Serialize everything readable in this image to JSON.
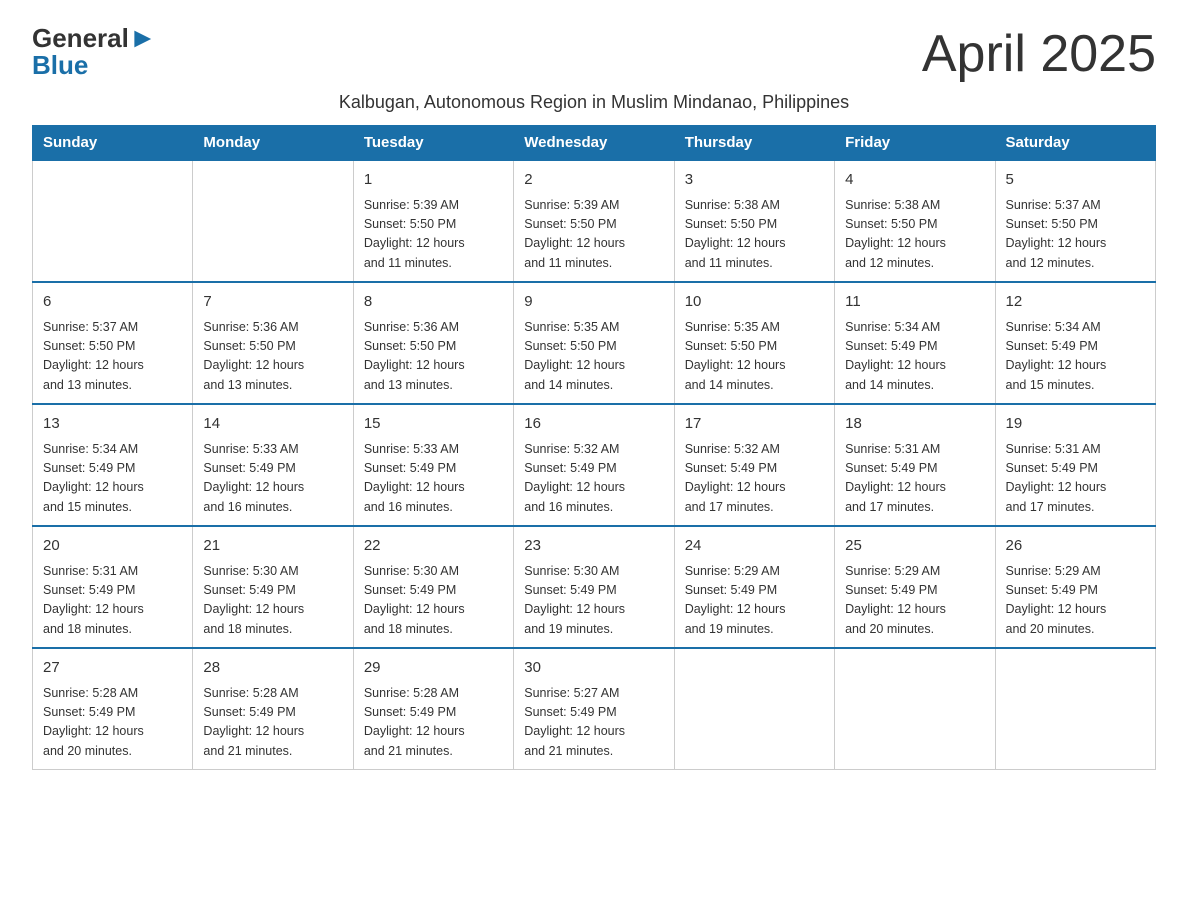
{
  "header": {
    "logo_general": "General",
    "logo_blue": "Blue",
    "month_title": "April 2025",
    "subtitle": "Kalbugan, Autonomous Region in Muslim Mindanao, Philippines"
  },
  "weekdays": [
    "Sunday",
    "Monday",
    "Tuesday",
    "Wednesday",
    "Thursday",
    "Friday",
    "Saturday"
  ],
  "weeks": [
    [
      {
        "day": "",
        "detail": ""
      },
      {
        "day": "",
        "detail": ""
      },
      {
        "day": "1",
        "detail": "Sunrise: 5:39 AM\nSunset: 5:50 PM\nDaylight: 12 hours\nand 11 minutes."
      },
      {
        "day": "2",
        "detail": "Sunrise: 5:39 AM\nSunset: 5:50 PM\nDaylight: 12 hours\nand 11 minutes."
      },
      {
        "day": "3",
        "detail": "Sunrise: 5:38 AM\nSunset: 5:50 PM\nDaylight: 12 hours\nand 11 minutes."
      },
      {
        "day": "4",
        "detail": "Sunrise: 5:38 AM\nSunset: 5:50 PM\nDaylight: 12 hours\nand 12 minutes."
      },
      {
        "day": "5",
        "detail": "Sunrise: 5:37 AM\nSunset: 5:50 PM\nDaylight: 12 hours\nand 12 minutes."
      }
    ],
    [
      {
        "day": "6",
        "detail": "Sunrise: 5:37 AM\nSunset: 5:50 PM\nDaylight: 12 hours\nand 13 minutes."
      },
      {
        "day": "7",
        "detail": "Sunrise: 5:36 AM\nSunset: 5:50 PM\nDaylight: 12 hours\nand 13 minutes."
      },
      {
        "day": "8",
        "detail": "Sunrise: 5:36 AM\nSunset: 5:50 PM\nDaylight: 12 hours\nand 13 minutes."
      },
      {
        "day": "9",
        "detail": "Sunrise: 5:35 AM\nSunset: 5:50 PM\nDaylight: 12 hours\nand 14 minutes."
      },
      {
        "day": "10",
        "detail": "Sunrise: 5:35 AM\nSunset: 5:50 PM\nDaylight: 12 hours\nand 14 minutes."
      },
      {
        "day": "11",
        "detail": "Sunrise: 5:34 AM\nSunset: 5:49 PM\nDaylight: 12 hours\nand 14 minutes."
      },
      {
        "day": "12",
        "detail": "Sunrise: 5:34 AM\nSunset: 5:49 PM\nDaylight: 12 hours\nand 15 minutes."
      }
    ],
    [
      {
        "day": "13",
        "detail": "Sunrise: 5:34 AM\nSunset: 5:49 PM\nDaylight: 12 hours\nand 15 minutes."
      },
      {
        "day": "14",
        "detail": "Sunrise: 5:33 AM\nSunset: 5:49 PM\nDaylight: 12 hours\nand 16 minutes."
      },
      {
        "day": "15",
        "detail": "Sunrise: 5:33 AM\nSunset: 5:49 PM\nDaylight: 12 hours\nand 16 minutes."
      },
      {
        "day": "16",
        "detail": "Sunrise: 5:32 AM\nSunset: 5:49 PM\nDaylight: 12 hours\nand 16 minutes."
      },
      {
        "day": "17",
        "detail": "Sunrise: 5:32 AM\nSunset: 5:49 PM\nDaylight: 12 hours\nand 17 minutes."
      },
      {
        "day": "18",
        "detail": "Sunrise: 5:31 AM\nSunset: 5:49 PM\nDaylight: 12 hours\nand 17 minutes."
      },
      {
        "day": "19",
        "detail": "Sunrise: 5:31 AM\nSunset: 5:49 PM\nDaylight: 12 hours\nand 17 minutes."
      }
    ],
    [
      {
        "day": "20",
        "detail": "Sunrise: 5:31 AM\nSunset: 5:49 PM\nDaylight: 12 hours\nand 18 minutes."
      },
      {
        "day": "21",
        "detail": "Sunrise: 5:30 AM\nSunset: 5:49 PM\nDaylight: 12 hours\nand 18 minutes."
      },
      {
        "day": "22",
        "detail": "Sunrise: 5:30 AM\nSunset: 5:49 PM\nDaylight: 12 hours\nand 18 minutes."
      },
      {
        "day": "23",
        "detail": "Sunrise: 5:30 AM\nSunset: 5:49 PM\nDaylight: 12 hours\nand 19 minutes."
      },
      {
        "day": "24",
        "detail": "Sunrise: 5:29 AM\nSunset: 5:49 PM\nDaylight: 12 hours\nand 19 minutes."
      },
      {
        "day": "25",
        "detail": "Sunrise: 5:29 AM\nSunset: 5:49 PM\nDaylight: 12 hours\nand 20 minutes."
      },
      {
        "day": "26",
        "detail": "Sunrise: 5:29 AM\nSunset: 5:49 PM\nDaylight: 12 hours\nand 20 minutes."
      }
    ],
    [
      {
        "day": "27",
        "detail": "Sunrise: 5:28 AM\nSunset: 5:49 PM\nDaylight: 12 hours\nand 20 minutes."
      },
      {
        "day": "28",
        "detail": "Sunrise: 5:28 AM\nSunset: 5:49 PM\nDaylight: 12 hours\nand 21 minutes."
      },
      {
        "day": "29",
        "detail": "Sunrise: 5:28 AM\nSunset: 5:49 PM\nDaylight: 12 hours\nand 21 minutes."
      },
      {
        "day": "30",
        "detail": "Sunrise: 5:27 AM\nSunset: 5:49 PM\nDaylight: 12 hours\nand 21 minutes."
      },
      {
        "day": "",
        "detail": ""
      },
      {
        "day": "",
        "detail": ""
      },
      {
        "day": "",
        "detail": ""
      }
    ]
  ]
}
